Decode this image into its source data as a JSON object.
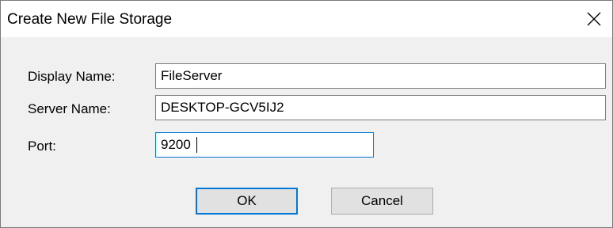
{
  "window": {
    "title": "Create New File Storage",
    "close_icon": "close-icon"
  },
  "form": {
    "display_name": {
      "label": "Display Name:",
      "value": "FileServer"
    },
    "server_name": {
      "label": "Server Name:",
      "value": "DESKTOP-GCV5IJ2"
    },
    "port": {
      "label": "Port:",
      "value": "9200"
    }
  },
  "buttons": {
    "ok_label": "OK",
    "cancel_label": "Cancel"
  },
  "colors": {
    "focus_accent": "#0078d7",
    "dialog_background": "#f0f0f0",
    "titlebar_background": "#ffffff"
  }
}
